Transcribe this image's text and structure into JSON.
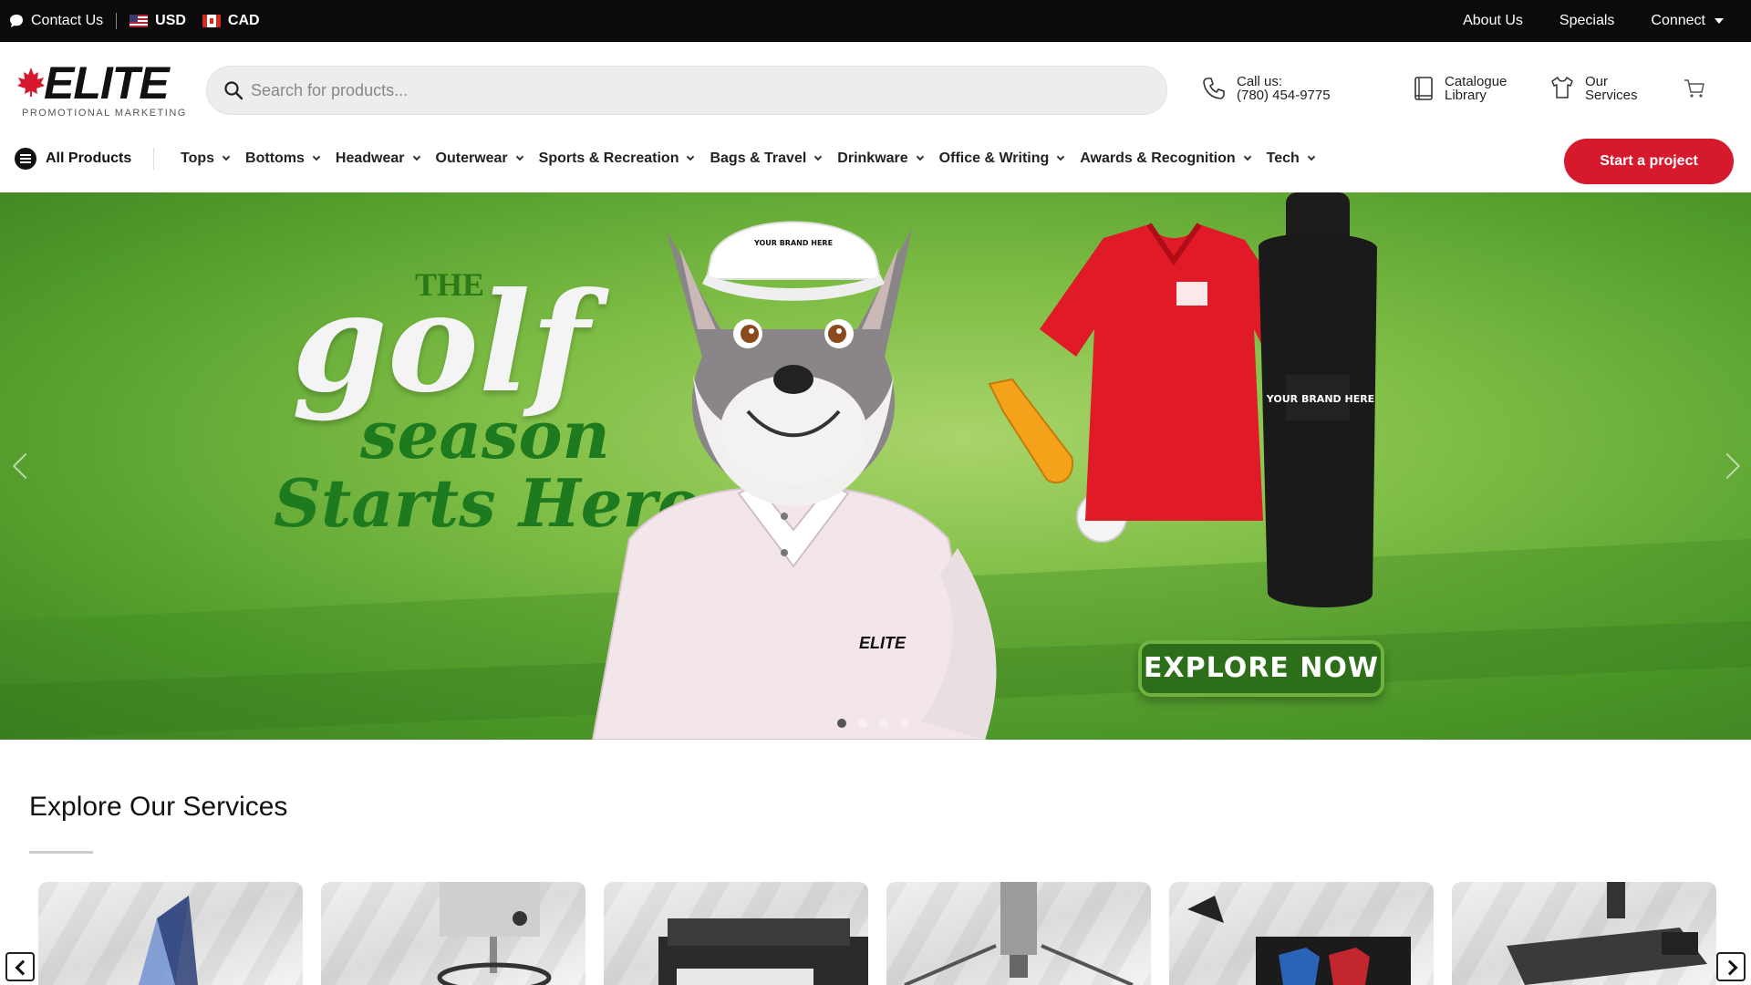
{
  "topbar": {
    "contact_label": "Contact Us",
    "currency_usd": "USD",
    "currency_cad": "CAD",
    "about_label": "About Us",
    "specials_label": "Specials",
    "connect_label": "Connect"
  },
  "header": {
    "logo_word": "ELITE",
    "logo_tagline": "PROMOTIONAL MARKETING",
    "search_placeholder": "Search for products...",
    "call_label": "Call us:",
    "call_number": "(780) 454-9775",
    "catalogue_line1": "Catalogue",
    "catalogue_line2": "Library",
    "services_line1": "Our",
    "services_line2": "Services"
  },
  "nav": {
    "all_products": "All Products",
    "items": [
      {
        "label": "Tops"
      },
      {
        "label": "Bottoms"
      },
      {
        "label": "Headwear"
      },
      {
        "label": "Outerwear"
      },
      {
        "label": "Sports & Recreation"
      },
      {
        "label": "Bags & Travel"
      },
      {
        "label": "Drinkware"
      },
      {
        "label": "Office & Writing"
      },
      {
        "label": "Awards & Recognition"
      },
      {
        "label": "Tech"
      }
    ],
    "cta_label": "Start a project"
  },
  "hero": {
    "line_the": "THE",
    "line_golf": "golf",
    "line_season": "season",
    "line_starts": "Starts Here",
    "cta_label": "EXPLORE NOW",
    "brand_text": "YOUR BRAND HERE",
    "shirt_brand": "ELITE",
    "slide_count": 4,
    "active_slide": 1
  },
  "services": {
    "title": "Explore Our Services",
    "cards": [
      {
        "icon": "award-icon"
      },
      {
        "icon": "embroidery-machine-icon"
      },
      {
        "icon": "printer-icon"
      },
      {
        "icon": "engraving-machine-icon"
      },
      {
        "icon": "design-monitor-icon"
      },
      {
        "icon": "heat-press-icon"
      }
    ]
  },
  "colors": {
    "accent": "#d7192d",
    "topbar_bg": "#0b0b0b",
    "hero_green": "#4f9a2a"
  }
}
